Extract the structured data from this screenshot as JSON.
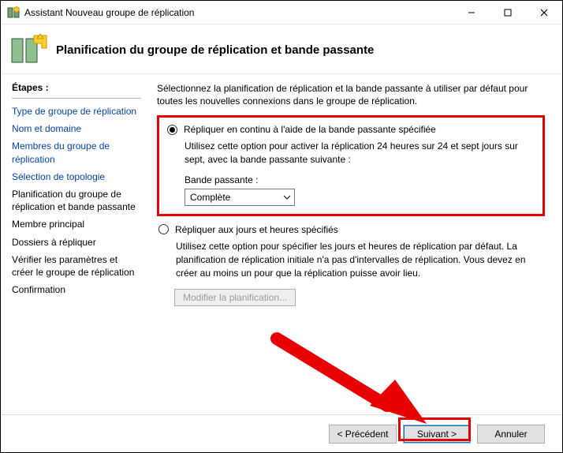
{
  "window": {
    "title": "Assistant Nouveau groupe de réplication"
  },
  "header": {
    "title": "Planification du groupe de réplication et bande passante"
  },
  "sidebar": {
    "heading": "Étapes :",
    "items": [
      {
        "label": "Type de groupe de réplication",
        "kind": "link"
      },
      {
        "label": "Nom et domaine",
        "kind": "link"
      },
      {
        "label": "Membres du groupe de réplication",
        "kind": "link"
      },
      {
        "label": "Sélection de topologie",
        "kind": "link"
      },
      {
        "label": "Planification du groupe de réplication et bande passante",
        "kind": "current"
      },
      {
        "label": "Membre principal",
        "kind": "plain"
      },
      {
        "label": "Dossiers à répliquer",
        "kind": "plain"
      },
      {
        "label": "Vérifier les paramètres et créer le groupe de réplication",
        "kind": "plain"
      },
      {
        "label": "Confirmation",
        "kind": "plain"
      }
    ]
  },
  "content": {
    "intro": "Sélectionnez la planification de réplication et la bande passante à utiliser par défaut pour toutes les nouvelles connexions dans le groupe de réplication.",
    "option1": {
      "label": "Répliquer en continu à l'aide de la bande passante spécifiée",
      "desc": "Utilisez cette option pour activer la réplication 24 heures sur 24 et sept jours sur sept, avec la bande passante suivante :",
      "bandwidth_label": "Bande passante :",
      "bandwidth_value": "Complète"
    },
    "option2": {
      "label": "Répliquer aux jours et heures spécifiés",
      "desc": "Utilisez cette option pour spécifier les jours et heures de réplication par défaut. La planification de réplication initiale n'a pas d'intervalles de réplication. Vous devez en créer au moins un pour que la réplication puisse avoir lieu.",
      "edit_button": "Modifier la planification..."
    }
  },
  "footer": {
    "prev": "< Précédent",
    "next": "Suivant >",
    "cancel": "Annuler"
  }
}
